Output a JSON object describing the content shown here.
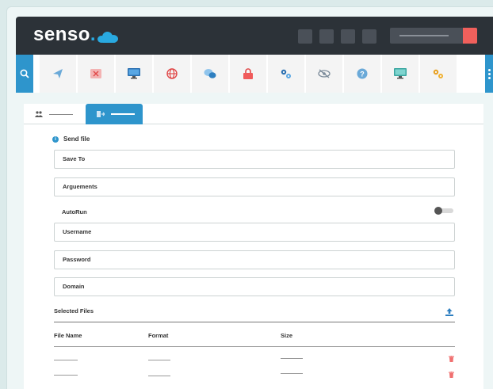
{
  "brand": {
    "name": "senso",
    "dot": "."
  },
  "tabs": [
    {
      "label": "",
      "icon": "users-icon",
      "active": false
    },
    {
      "label": "",
      "icon": "send-file-icon",
      "active": true
    }
  ],
  "form": {
    "section_title": "Send file",
    "save_to_placeholder": "Save To",
    "arguments_placeholder": "Arguements",
    "autorun_label": "AutoRun",
    "autorun_enabled": false,
    "username_placeholder": "Username",
    "password_placeholder": "Password",
    "domain_placeholder": "Domain"
  },
  "files": {
    "title": "Selected Files",
    "columns": [
      "File Name",
      "Format",
      "Size"
    ],
    "rows": [
      {
        "name": "",
        "format": "",
        "size": ""
      },
      {
        "name": "",
        "format": "",
        "size": ""
      }
    ]
  },
  "colors": {
    "topbar": "#2c3238",
    "accent": "#2e95cc",
    "danger": "#f0605c"
  }
}
